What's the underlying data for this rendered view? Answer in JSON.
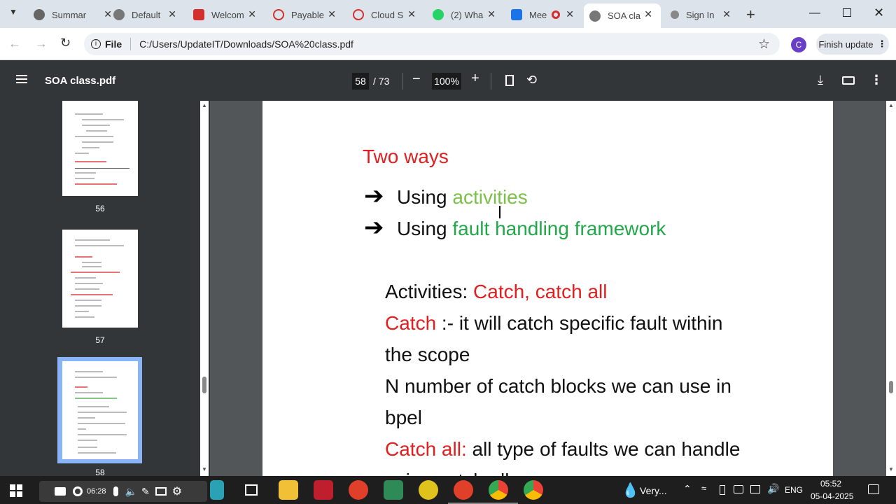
{
  "browser": {
    "tabs": [
      {
        "label": "Summar",
        "icon": "github-icon",
        "color": "#555"
      },
      {
        "label": "Default",
        "icon": "globe-icon",
        "color": "#555"
      },
      {
        "label": "Welcom",
        "icon": "oracle-icon",
        "color": "#d32f2f"
      },
      {
        "label": "Payable",
        "icon": "oracle-icon",
        "color": "#d32f2f"
      },
      {
        "label": "Cloud S",
        "icon": "oracle-icon",
        "color": "#d32f2f"
      },
      {
        "label": "(2) Wha",
        "icon": "whatsapp-icon",
        "color": "#25d366"
      },
      {
        "label": "Mee",
        "icon": "meet-icon",
        "color": "#1a73e8"
      },
      {
        "label": "SOA cla",
        "icon": "globe-icon",
        "color": "#555"
      },
      {
        "label": "Sign In",
        "icon": "key-icon",
        "color": "#555"
      }
    ],
    "address": "C:/Users/UpdateIT/Downloads/SOA%20class.pdf",
    "file_chip": "File",
    "profile_initial": "C",
    "finish_update": "Finish update"
  },
  "pdf": {
    "title": "SOA class.pdf",
    "current_page": "58",
    "total_pages": "/ 73",
    "zoom": "100%"
  },
  "thumbnails": [
    {
      "page": "56"
    },
    {
      "page": "57"
    },
    {
      "page": "58"
    }
  ],
  "content": {
    "heading": "Two ways",
    "bullet1_prefix": "Using ",
    "bullet1_highlight": "activities",
    "bullet2_prefix": "Using ",
    "bullet2_highlight": "fault handling framework",
    "line1_prefix": "Activities: ",
    "line1_highlight": "Catch, catch all",
    "line2_prefix": "Catch",
    "line2_rest": " :- it will catch specific fault within",
    "line3": "the scope",
    "line4": "N number of catch blocks we can use in",
    "line5": "bpel",
    "line6_prefix": "Catch all:",
    "line6_rest": " all type of faults we can handle",
    "line7": "using catch all"
  },
  "taskbar": {
    "record_time": "06:28",
    "weather": "Very...",
    "language": "ENG",
    "time": "05:52",
    "date": "05-04-2025"
  },
  "colors": {
    "red": "#e02020",
    "light_green": "#7cc04a",
    "green": "#22a84a",
    "accent": "#1a73e8"
  }
}
